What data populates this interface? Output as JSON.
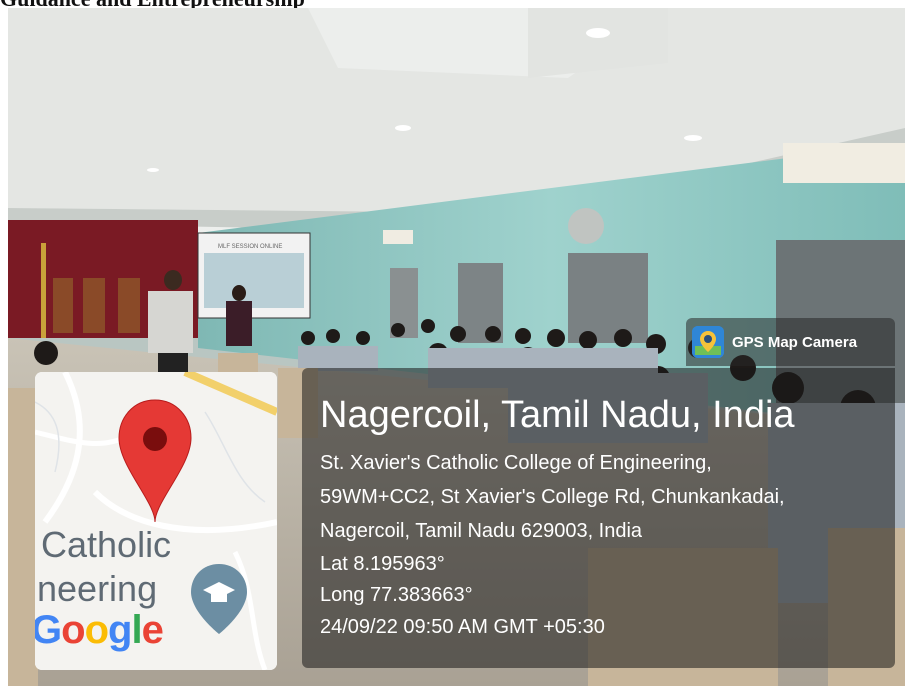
{
  "page": {
    "heading": "Guidance and Entrepreneurship"
  },
  "photo": {
    "projector_slide_title": "MLF SESSION ONLINE"
  },
  "map": {
    "label_catholic": "Catholic",
    "label_engineering": "ineering",
    "logo_letters": [
      "G",
      "o",
      "o",
      "g",
      "l",
      "e"
    ],
    "pin_color": "#e53935",
    "marker_icon": "graduation-cap-icon"
  },
  "overlay": {
    "app_name": "GPS Map Camera",
    "app_icon": "gps-map-camera-icon",
    "city_line": "Nagercoil, Tamil Nadu, India",
    "address_line_1": "St. Xavier's Catholic College of Engineering,",
    "address_line_2": "59WM+CC2, St Xavier's College Rd, Chunkankadai,",
    "address_line_3": "Nagercoil, Tamil Nadu 629003, India",
    "latitude": "Lat 8.195963°",
    "longitude": "Long 77.383663°",
    "timestamp": "24/09/22 09:50 AM GMT +05:30"
  }
}
